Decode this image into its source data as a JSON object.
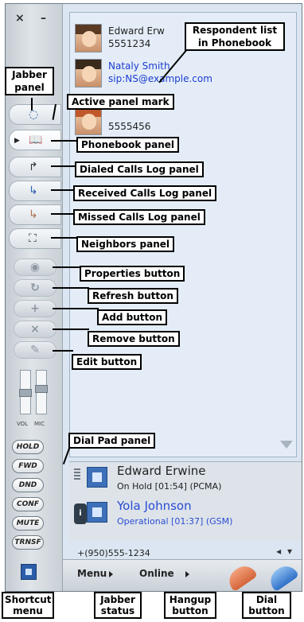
{
  "window": {
    "close_glyph": "×",
    "minimize_glyph": "–"
  },
  "contacts": [
    {
      "name": "Edward Erw",
      "number": "5551234",
      "selected": false
    },
    {
      "name": "Nataly Smith",
      "number": "sip:NS@example.com",
      "selected": true
    },
    {
      "name": "",
      "number": "5555456",
      "selected": false
    }
  ],
  "panels": {
    "jabber": {
      "icon": "jabber-icon"
    },
    "phonebook": {
      "icon": "phonebook-icon"
    },
    "dialed": {
      "icon": "dialed-calls-icon"
    },
    "received": {
      "icon": "received-calls-icon"
    },
    "missed": {
      "icon": "missed-calls-icon"
    },
    "neighbors": {
      "icon": "neighbors-icon"
    }
  },
  "tools": {
    "properties": "◉",
    "refresh": "↻",
    "add": "+",
    "remove": "×",
    "edit": "✎"
  },
  "volume": {
    "vol_label": "VOL",
    "mic_label": "MIC",
    "vol_level": 0.5,
    "mic_level": 0.6
  },
  "call_buttons": [
    "HOLD",
    "FWD",
    "DND",
    "CONF",
    "MUTE",
    "TRNSF"
  ],
  "calls": [
    {
      "name": "Edward Erwine",
      "status": "On Hold [01:54] (PCMA)",
      "active": false
    },
    {
      "name": "Yola Johnson",
      "status": "Operational [01:37] (GSM)",
      "active": true
    }
  ],
  "dial": {
    "number": "+(950)555-1234",
    "nav": "◂ ▾"
  },
  "bottom": {
    "menu": "Menu",
    "status": "Online"
  },
  "callouts": {
    "respondent": "Respondent list\nin Phonebook",
    "jabber": "Jabber\npanel",
    "active_mark": "Active panel mark",
    "phonebook": "Phonebook panel",
    "dialed": "Dialed Calls Log panel",
    "received": "Received Calls Log panel",
    "missed": "Missed Calls Log panel",
    "neighbors": "Neighbors panel",
    "properties": "Properties button",
    "refresh": "Refresh button",
    "add": "Add button",
    "remove": "Remove button",
    "edit": "Edit button",
    "dialpad": "Dial Pad panel",
    "shortcut": "Shortcut\nmenu",
    "jabber_status": "Jabber\nstatus",
    "hangup": "Hangup\nbutton",
    "dial_btn": "Dial\nbutton"
  }
}
